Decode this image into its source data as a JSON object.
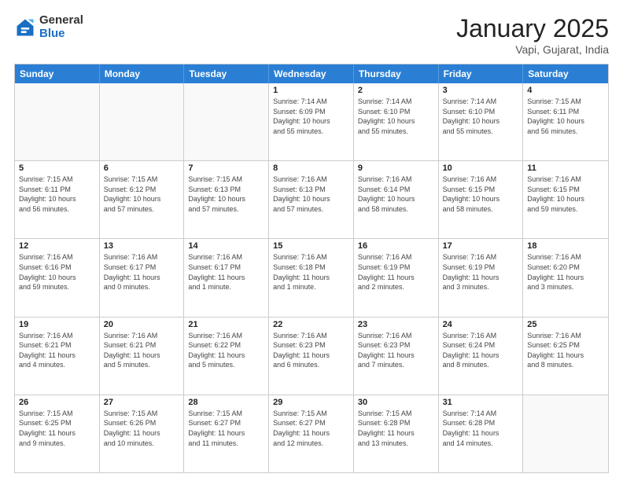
{
  "header": {
    "logo_general": "General",
    "logo_blue": "Blue",
    "month_title": "January 2025",
    "location": "Vapi, Gujarat, India"
  },
  "weekdays": [
    "Sunday",
    "Monday",
    "Tuesday",
    "Wednesday",
    "Thursday",
    "Friday",
    "Saturday"
  ],
  "rows": [
    [
      {
        "day": "",
        "info": ""
      },
      {
        "day": "",
        "info": ""
      },
      {
        "day": "",
        "info": ""
      },
      {
        "day": "1",
        "info": "Sunrise: 7:14 AM\nSunset: 6:09 PM\nDaylight: 10 hours\nand 55 minutes."
      },
      {
        "day": "2",
        "info": "Sunrise: 7:14 AM\nSunset: 6:10 PM\nDaylight: 10 hours\nand 55 minutes."
      },
      {
        "day": "3",
        "info": "Sunrise: 7:14 AM\nSunset: 6:10 PM\nDaylight: 10 hours\nand 55 minutes."
      },
      {
        "day": "4",
        "info": "Sunrise: 7:15 AM\nSunset: 6:11 PM\nDaylight: 10 hours\nand 56 minutes."
      }
    ],
    [
      {
        "day": "5",
        "info": "Sunrise: 7:15 AM\nSunset: 6:11 PM\nDaylight: 10 hours\nand 56 minutes."
      },
      {
        "day": "6",
        "info": "Sunrise: 7:15 AM\nSunset: 6:12 PM\nDaylight: 10 hours\nand 57 minutes."
      },
      {
        "day": "7",
        "info": "Sunrise: 7:15 AM\nSunset: 6:13 PM\nDaylight: 10 hours\nand 57 minutes."
      },
      {
        "day": "8",
        "info": "Sunrise: 7:16 AM\nSunset: 6:13 PM\nDaylight: 10 hours\nand 57 minutes."
      },
      {
        "day": "9",
        "info": "Sunrise: 7:16 AM\nSunset: 6:14 PM\nDaylight: 10 hours\nand 58 minutes."
      },
      {
        "day": "10",
        "info": "Sunrise: 7:16 AM\nSunset: 6:15 PM\nDaylight: 10 hours\nand 58 minutes."
      },
      {
        "day": "11",
        "info": "Sunrise: 7:16 AM\nSunset: 6:15 PM\nDaylight: 10 hours\nand 59 minutes."
      }
    ],
    [
      {
        "day": "12",
        "info": "Sunrise: 7:16 AM\nSunset: 6:16 PM\nDaylight: 10 hours\nand 59 minutes."
      },
      {
        "day": "13",
        "info": "Sunrise: 7:16 AM\nSunset: 6:17 PM\nDaylight: 11 hours\nand 0 minutes."
      },
      {
        "day": "14",
        "info": "Sunrise: 7:16 AM\nSunset: 6:17 PM\nDaylight: 11 hours\nand 1 minute."
      },
      {
        "day": "15",
        "info": "Sunrise: 7:16 AM\nSunset: 6:18 PM\nDaylight: 11 hours\nand 1 minute."
      },
      {
        "day": "16",
        "info": "Sunrise: 7:16 AM\nSunset: 6:19 PM\nDaylight: 11 hours\nand 2 minutes."
      },
      {
        "day": "17",
        "info": "Sunrise: 7:16 AM\nSunset: 6:19 PM\nDaylight: 11 hours\nand 3 minutes."
      },
      {
        "day": "18",
        "info": "Sunrise: 7:16 AM\nSunset: 6:20 PM\nDaylight: 11 hours\nand 3 minutes."
      }
    ],
    [
      {
        "day": "19",
        "info": "Sunrise: 7:16 AM\nSunset: 6:21 PM\nDaylight: 11 hours\nand 4 minutes."
      },
      {
        "day": "20",
        "info": "Sunrise: 7:16 AM\nSunset: 6:21 PM\nDaylight: 11 hours\nand 5 minutes."
      },
      {
        "day": "21",
        "info": "Sunrise: 7:16 AM\nSunset: 6:22 PM\nDaylight: 11 hours\nand 5 minutes."
      },
      {
        "day": "22",
        "info": "Sunrise: 7:16 AM\nSunset: 6:23 PM\nDaylight: 11 hours\nand 6 minutes."
      },
      {
        "day": "23",
        "info": "Sunrise: 7:16 AM\nSunset: 6:23 PM\nDaylight: 11 hours\nand 7 minutes."
      },
      {
        "day": "24",
        "info": "Sunrise: 7:16 AM\nSunset: 6:24 PM\nDaylight: 11 hours\nand 8 minutes."
      },
      {
        "day": "25",
        "info": "Sunrise: 7:16 AM\nSunset: 6:25 PM\nDaylight: 11 hours\nand 8 minutes."
      }
    ],
    [
      {
        "day": "26",
        "info": "Sunrise: 7:15 AM\nSunset: 6:25 PM\nDaylight: 11 hours\nand 9 minutes."
      },
      {
        "day": "27",
        "info": "Sunrise: 7:15 AM\nSunset: 6:26 PM\nDaylight: 11 hours\nand 10 minutes."
      },
      {
        "day": "28",
        "info": "Sunrise: 7:15 AM\nSunset: 6:27 PM\nDaylight: 11 hours\nand 11 minutes."
      },
      {
        "day": "29",
        "info": "Sunrise: 7:15 AM\nSunset: 6:27 PM\nDaylight: 11 hours\nand 12 minutes."
      },
      {
        "day": "30",
        "info": "Sunrise: 7:15 AM\nSunset: 6:28 PM\nDaylight: 11 hours\nand 13 minutes."
      },
      {
        "day": "31",
        "info": "Sunrise: 7:14 AM\nSunset: 6:28 PM\nDaylight: 11 hours\nand 14 minutes."
      },
      {
        "day": "",
        "info": ""
      }
    ]
  ]
}
